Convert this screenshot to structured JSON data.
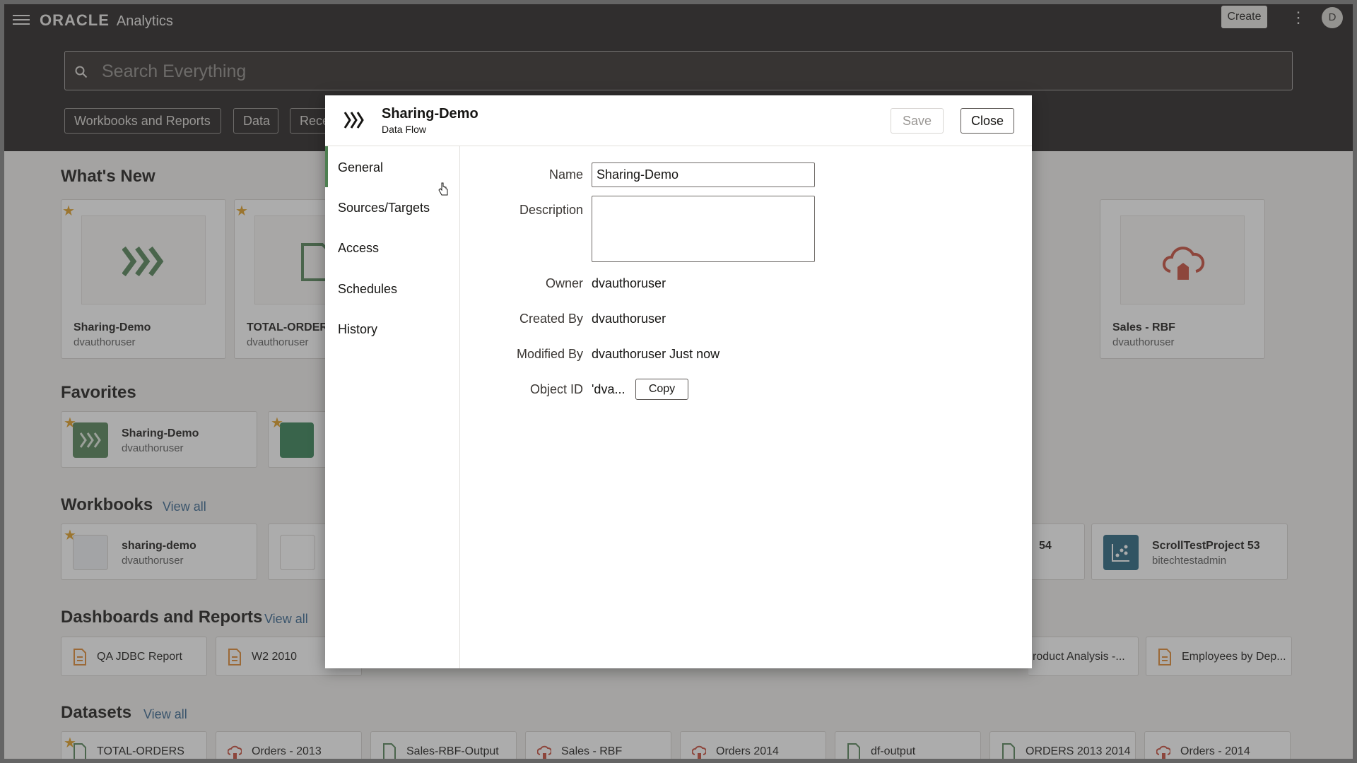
{
  "topbar": {
    "brand": "ORACLE",
    "product": "Analytics",
    "create_label": "Create",
    "avatar_initial": "D",
    "search_placeholder": "Search Everything",
    "chips": [
      "Workbooks and Reports",
      "Data",
      "Rece"
    ]
  },
  "whats_new": {
    "title": "What's New",
    "cards": [
      {
        "name": "Sharing-Demo",
        "owner": "dvauthoruser",
        "icon": "data-flow-icon"
      },
      {
        "name": "TOTAL-ORDERS",
        "owner": "dvauthoruser",
        "icon": "csv-file-icon"
      },
      {
        "name": "Sales - RBF",
        "owner": "dvauthoruser",
        "icon": "cloud-building-icon"
      }
    ]
  },
  "favorites": {
    "title": "Favorites",
    "items": [
      {
        "name": "Sharing-Demo",
        "owner": "dvauthoruser"
      }
    ]
  },
  "workbooks": {
    "title": "Workbooks",
    "view_all": "View all",
    "items": [
      {
        "name": "sharing-demo",
        "owner": "dvauthoruser"
      },
      {
        "name": "54",
        "owner": ""
      },
      {
        "name": "ScrollTestProject 53",
        "owner": "bitechtestadmin"
      }
    ]
  },
  "dashboards": {
    "title": "Dashboards and Reports",
    "view_all": "View all",
    "items": [
      "QA JDBC Report",
      "W2 2010",
      "roduct Analysis -...",
      "Employees by Dep..."
    ]
  },
  "datasets": {
    "title": "Datasets",
    "view_all": "View all",
    "items": [
      "TOTAL-ORDERS",
      "Orders - 2013",
      "Sales-RBF-Output",
      "Sales - RBF",
      "Orders 2014",
      "df-output",
      "ORDERS 2013 2014",
      "Orders - 2014"
    ]
  },
  "dialog": {
    "title": "Sharing-Demo",
    "subtitle": "Data Flow",
    "save_label": "Save",
    "close_label": "Close",
    "nav": [
      "General",
      "Sources/Targets",
      "Access",
      "Schedules",
      "History"
    ],
    "active_nav": "General",
    "fields": {
      "name_label": "Name",
      "name_value": "Sharing-Demo",
      "description_label": "Description",
      "description_value": "",
      "owner_label": "Owner",
      "owner_value": "dvauthoruser",
      "created_by_label": "Created By",
      "created_by_value": "dvauthoruser",
      "modified_by_label": "Modified By",
      "modified_by_value": "dvauthoruser Just now",
      "object_id_label": "Object ID",
      "object_id_value": "'dva...",
      "copy_label": "Copy"
    }
  },
  "colors": {
    "accent_green": "#4d7f51",
    "star": "#e09c1c",
    "topbar_bg": "#1e1b1a",
    "link": "#2f5f8a"
  }
}
